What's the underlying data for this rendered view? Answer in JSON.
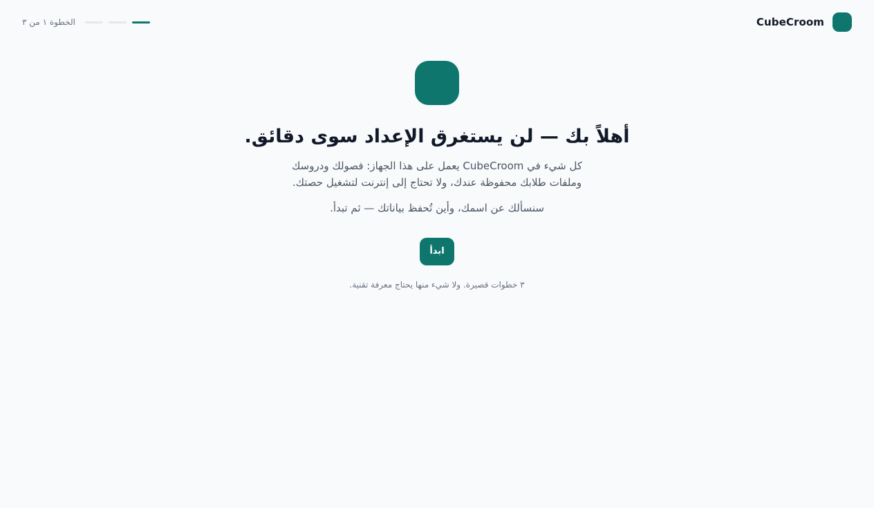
{
  "app": {
    "name": "CubeCroom"
  },
  "progress": {
    "label": "الخطوة ١ من ٣",
    "current_step": 1,
    "total_steps": 3
  },
  "welcome": {
    "title": "أهلاً بك — لن يستغرق الإعداد سوى دقائق.",
    "description": "كل شيء في CubeCroom يعمل على هذا الجهاز: فصولك ودروسك وملفات طلابك محفوظة عندك، ولا تحتاج إلى إنترنت لتشغيل حصتك.",
    "description_2": "سنسألك عن اسمك، وأين تُحفظ بياناتك — ثم تبدأ.",
    "start_label": "ابدأ",
    "hint": "٣ خطوات قصيرة. ولا شيء منها يحتاج معرفة تقنية."
  },
  "colors": {
    "accent": "#0f766e",
    "background": "#f8fafc",
    "track": "#e5e7eb",
    "heading": "#111827",
    "body_text": "#4b5563",
    "muted_text": "#6b7280"
  }
}
